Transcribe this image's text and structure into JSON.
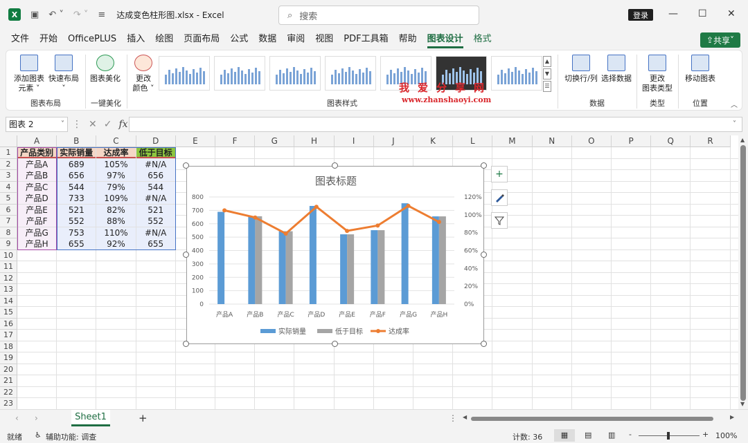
{
  "app": {
    "logo": "X",
    "title": "达成变色柱形图.xlsx  -  Excel",
    "search_placeholder": "搜索",
    "login": "登录",
    "share": "共享",
    "win_min": "—",
    "win_max": "☐",
    "win_close": "✕"
  },
  "menu": [
    "文件",
    "开始",
    "OfficePLUS",
    "插入",
    "绘图",
    "页面布局",
    "公式",
    "数据",
    "审阅",
    "视图",
    "PDF工具箱",
    "帮助",
    "图表设计",
    "格式"
  ],
  "ribbon": {
    "add_element": "添加图表\n元素 ˅",
    "quick_layout": "快速布局\n˅",
    "group_layout": "图表布局",
    "beautify": "图表美化",
    "group_beautify": "一键美化",
    "change_color": "更改\n颜色 ˅",
    "group_styles": "图表样式",
    "switch_rowcol": "切换行/列",
    "select_data": "选择数据",
    "group_data": "数据",
    "change_type": "更改\n图表类型",
    "group_type": "类型",
    "move_chart": "移动图表",
    "group_position": "位置"
  },
  "watermark": {
    "cn": "我爱分享网",
    "url": "www.zhanshaoyi.com"
  },
  "namebox": "图表 2",
  "fx": "fx",
  "columns": [
    "A",
    "B",
    "C",
    "D",
    "E",
    "F",
    "G",
    "H",
    "I",
    "J",
    "K",
    "L",
    "M",
    "N",
    "O",
    "P",
    "Q",
    "R"
  ],
  "rows": [
    "1",
    "2",
    "3",
    "4",
    "5",
    "6",
    "7",
    "8",
    "9",
    "10",
    "11",
    "12",
    "13",
    "14",
    "15",
    "16",
    "17",
    "18",
    "19",
    "20",
    "21",
    "22",
    "23"
  ],
  "table": {
    "headers": [
      "产品类别",
      "实际销量",
      "达成率",
      "低于目标"
    ],
    "data": [
      [
        "产品A",
        "689",
        "105%",
        "#N/A"
      ],
      [
        "产品B",
        "656",
        "97%",
        "656"
      ],
      [
        "产品C",
        "544",
        "79%",
        "544"
      ],
      [
        "产品D",
        "733",
        "109%",
        "#N/A"
      ],
      [
        "产品E",
        "521",
        "82%",
        "521"
      ],
      [
        "产品F",
        "552",
        "88%",
        "552"
      ],
      [
        "产品G",
        "753",
        "110%",
        "#N/A"
      ],
      [
        "产品H",
        "655",
        "92%",
        "655"
      ]
    ]
  },
  "chart_data": {
    "type": "bar",
    "title": "图表标题",
    "categories": [
      "产品A",
      "产品B",
      "产品C",
      "产品D",
      "产品E",
      "产品F",
      "产品G",
      "产品H"
    ],
    "series": [
      {
        "name": "实际销量",
        "type": "bar",
        "values": [
          689,
          656,
          544,
          733,
          521,
          552,
          753,
          655
        ],
        "color": "#5b9bd5"
      },
      {
        "name": "低于目标",
        "type": "bar",
        "values": [
          null,
          656,
          544,
          null,
          521,
          552,
          null,
          655
        ],
        "color": "#a5a5a5"
      },
      {
        "name": "达成率",
        "type": "line",
        "axis": "secondary",
        "values": [
          1.05,
          0.97,
          0.79,
          1.09,
          0.82,
          0.88,
          1.1,
          0.92
        ],
        "color": "#ed7d31"
      }
    ],
    "ylim": [
      0,
      800
    ],
    "y_ticks": [
      "0",
      "100",
      "200",
      "300",
      "400",
      "500",
      "600",
      "700",
      "800"
    ],
    "y2lim": [
      0,
      1.2
    ],
    "y2_ticks": [
      "0%",
      "20%",
      "40%",
      "60%",
      "80%",
      "100%",
      "120%"
    ],
    "legend": "bottom",
    "grid": true
  },
  "side_buttons": {
    "add": "+",
    "style": "brush",
    "filter": "filter"
  },
  "sheet": {
    "tab": "Sheet1",
    "add": "+"
  },
  "status": {
    "ready": "就绪",
    "accessibility": "辅助功能: 调查",
    "count": "计数: 36",
    "zoom": "100%",
    "zoom_minus": "-",
    "zoom_plus": "+"
  }
}
